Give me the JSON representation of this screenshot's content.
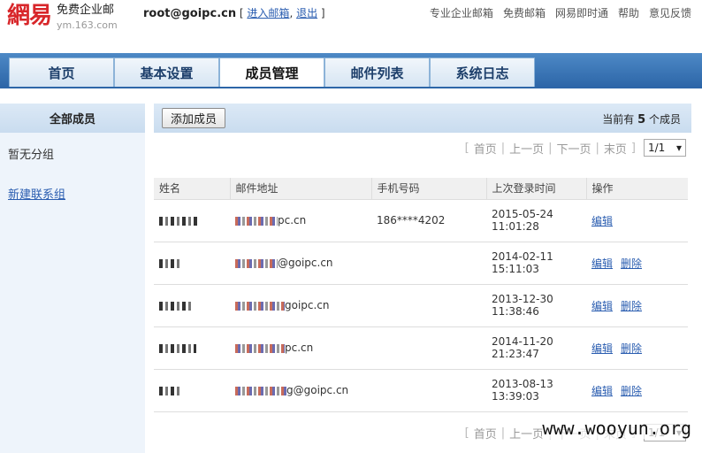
{
  "header": {
    "logo_mark": "網易",
    "logo_title": "免费企业邮",
    "logo_sub": "ym.163.com",
    "account_email": "root@goipc.cn",
    "link_enter_mail": "进入邮箱",
    "link_logout": "退出",
    "top_links": [
      "专业企业邮箱",
      "免费邮箱",
      "网易即时通",
      "帮助",
      "意见反馈"
    ]
  },
  "nav": {
    "tabs": [
      {
        "label": "首页",
        "active": false
      },
      {
        "label": "基本设置",
        "active": false
      },
      {
        "label": "成员管理",
        "active": true
      },
      {
        "label": "邮件列表",
        "active": false
      },
      {
        "label": "系统日志",
        "active": false
      }
    ]
  },
  "sidebar": {
    "header": "全部成员",
    "no_group": "暂无分组",
    "new_group_link": "新建联系组"
  },
  "toolbar": {
    "add_button": "添加成员",
    "count_prefix": "当前有",
    "count_value": "5",
    "count_suffix": "个成员"
  },
  "pager": {
    "first": "首页",
    "prev": "上一页",
    "next": "下一页",
    "last": "末页",
    "page_value": "1/1"
  },
  "table": {
    "columns": [
      "姓名",
      "邮件地址",
      "手机号码",
      "上次登录时间",
      "操作"
    ],
    "rows": [
      {
        "email_suffix": "pc.cn",
        "phone": "186****4202",
        "date": "2015-05-24",
        "time": "11:01:28",
        "edit": "编辑",
        "delete": ""
      },
      {
        "email_suffix": "@goipc.cn",
        "phone": "",
        "date": "2014-02-11",
        "time": "15:11:03",
        "edit": "编辑",
        "delete": "删除"
      },
      {
        "email_suffix": "goipc.cn",
        "phone": "",
        "date": "2013-12-30",
        "time": "11:38:46",
        "edit": "编辑",
        "delete": "删除"
      },
      {
        "email_suffix": "pc.cn",
        "phone": "",
        "date": "2014-11-20",
        "time": "21:23:47",
        "edit": "编辑",
        "delete": "删除"
      },
      {
        "email_suffix": "g@goipc.cn",
        "phone": "",
        "date": "2013-08-13",
        "time": "13:39:03",
        "edit": "编辑",
        "delete": "删除"
      }
    ]
  },
  "watermark": "www.wooyun.org"
}
